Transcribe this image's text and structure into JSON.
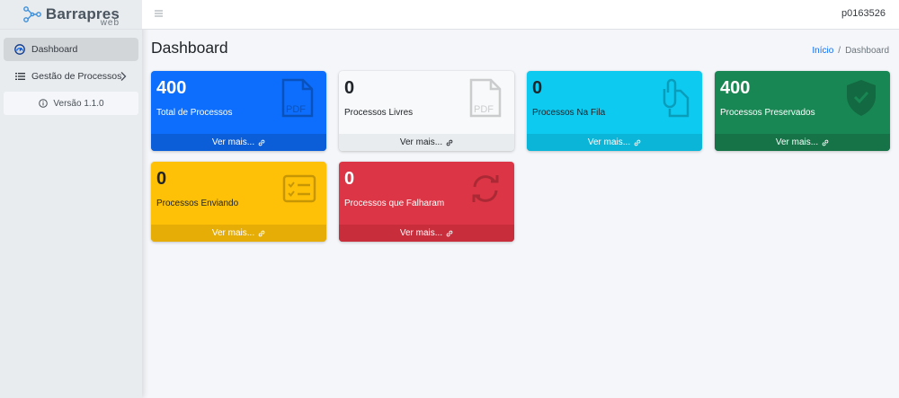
{
  "brand": {
    "name": "Barrapres",
    "sub": "web"
  },
  "sidebar": {
    "items": [
      {
        "label": "Dashboard",
        "icon": "gauge-icon"
      },
      {
        "label": "Gestão de Processos",
        "icon": "list-icon"
      }
    ],
    "version": "Versão 1.1.0"
  },
  "topbar": {
    "user": "p0163526"
  },
  "page": {
    "title": "Dashboard",
    "breadcrumb": {
      "home": "Início",
      "sep": "/",
      "current": "Dashboard"
    }
  },
  "boxes": [
    {
      "value": "400",
      "label": "Total de Processos",
      "footer": "Ver mais...",
      "icon": "file-pdf-icon",
      "color": "#0d6efd"
    },
    {
      "value": "0",
      "label": "Processos Livres",
      "footer": "Ver mais...",
      "icon": "file-pdf-icon",
      "color": "#f8f9fa"
    },
    {
      "value": "0",
      "label": "Processos Na Fila",
      "footer": "Ver mais...",
      "icon": "paperclip-file-icon",
      "color": "#0dcaf0"
    },
    {
      "value": "400",
      "label": "Processos Preservados",
      "footer": "Ver mais...",
      "icon": "shield-check-icon",
      "color": "#198754"
    },
    {
      "value": "0",
      "label": "Processos Enviando",
      "footer": "Ver mais...",
      "icon": "card-checklist-icon",
      "color": "#ffc107"
    },
    {
      "value": "0",
      "label": "Processos que Falharam",
      "footer": "Ver mais...",
      "icon": "arrow-repeat-icon",
      "color": "#dc3545"
    }
  ],
  "pdf_icon_text": "PDF"
}
